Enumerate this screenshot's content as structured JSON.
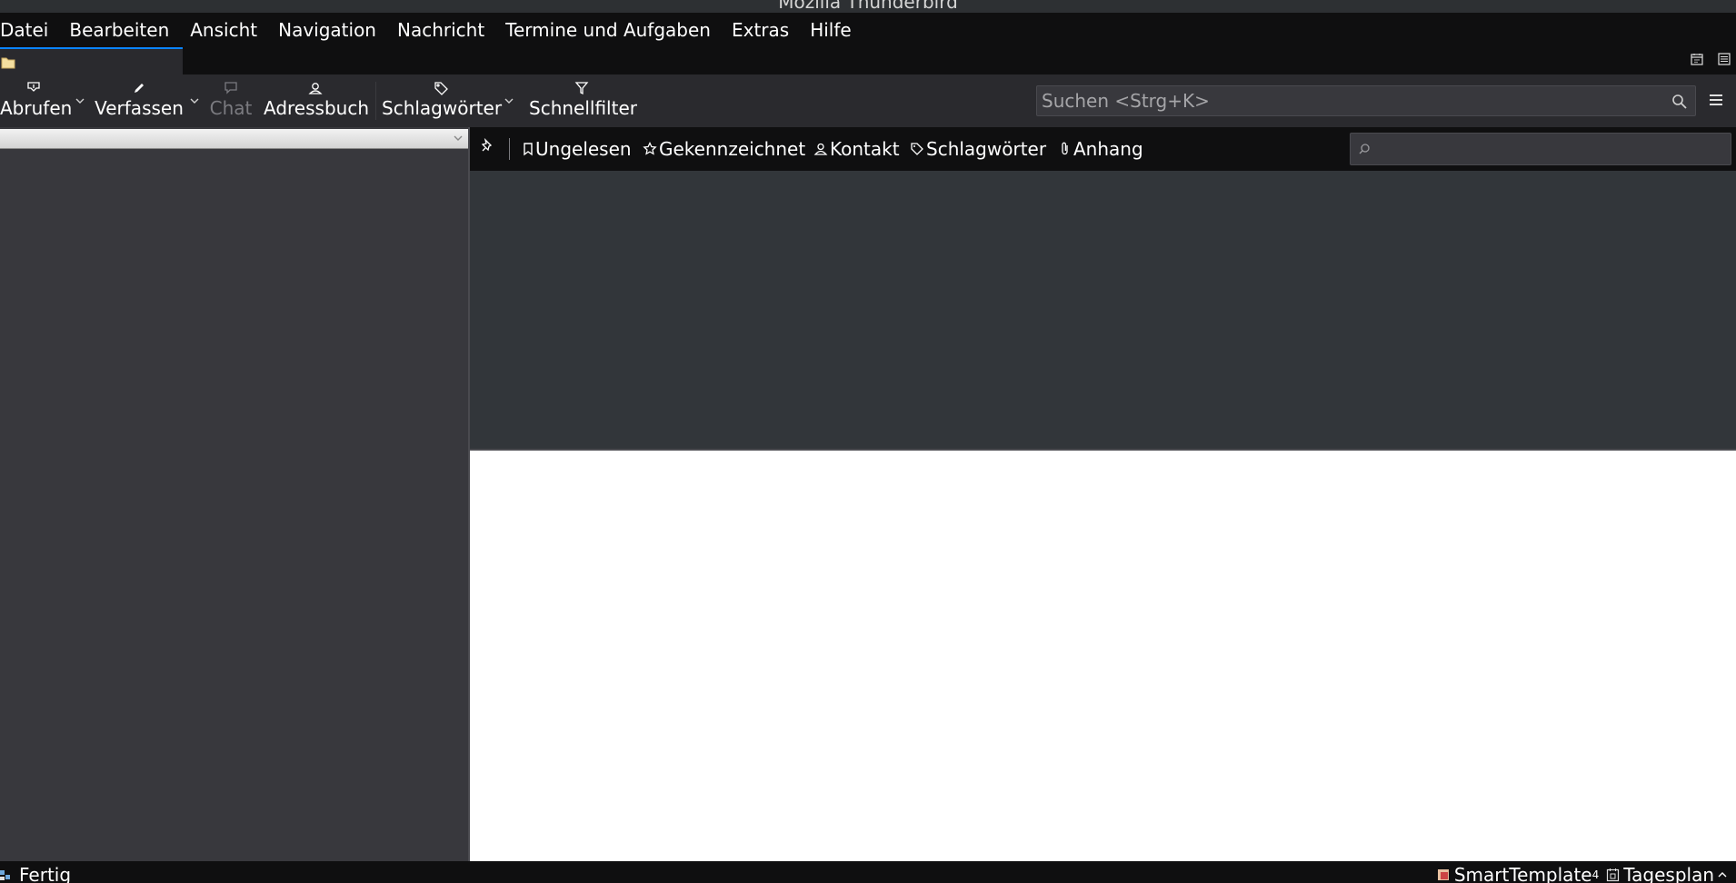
{
  "window": {
    "title": "Mozilla Thunderbird"
  },
  "menubar": {
    "items": [
      {
        "label": "Datei"
      },
      {
        "label": "Bearbeiten"
      },
      {
        "label": "Ansicht"
      },
      {
        "label": "Navigation"
      },
      {
        "label": "Nachricht"
      },
      {
        "label": "Termine und Aufgaben"
      },
      {
        "label": "Extras"
      },
      {
        "label": "Hilfe"
      }
    ]
  },
  "toolbar": {
    "get_messages": "Abrufen",
    "compose": "Verfassen",
    "chat": "Chat",
    "address_book": "Adressbuch",
    "tags": "Schlagwörter",
    "quick_filter": "Schnellfilter",
    "search_placeholder": "Suchen <Strg+K>"
  },
  "quickfilter": {
    "unread": "Ungelesen",
    "starred": "Gekennzeichnet",
    "contact": "Kontakt",
    "tags": "Schlagwörter",
    "attachment": "Anhang",
    "filter_value": ""
  },
  "statusbar": {
    "status_text": "Fertig",
    "smarttemplate": "SmartTemplate",
    "smarttemplate_sup": "4",
    "today_pane": "Tagesplan"
  },
  "colors": {
    "accent": "#0a84ff",
    "toolbar_bg": "#2a2a2e",
    "menubar_bg": "#0f0f10",
    "folderpane_bg": "#38383d",
    "threadpane_bg": "#32363a",
    "messagepane_bg": "#ffffff"
  }
}
